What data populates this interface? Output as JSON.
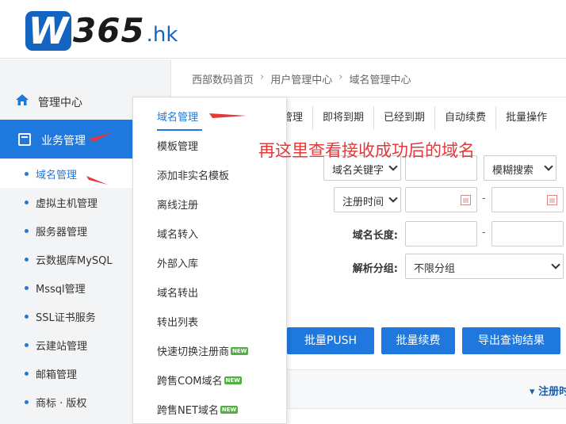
{
  "logo": {
    "mark": "W",
    "number": "365",
    "suffix": ".hk"
  },
  "sidebar": {
    "management_center": "管理中心",
    "business_management": "业务管理",
    "items": [
      "域名管理",
      "虚拟主机管理",
      "服务器管理",
      "云数据库MySQL",
      "Mssql管理",
      "SSL证书服务",
      "云建站管理",
      "邮箱管理",
      "商标 · 版权"
    ]
  },
  "breadcrumb": [
    "西部数码首页",
    "用户管理中心",
    "域名管理中心"
  ],
  "tabs": [
    "管理",
    "即将到期",
    "已经到期",
    "自动续费",
    "批量操作"
  ],
  "annotation": "再这里查看接收成功后的域名",
  "search": {
    "keyword_select": "域名关键字",
    "mode_select": "模糊搜索",
    "date_select": "注册时间",
    "length_label": "域名长度:",
    "group_label": "解析分组:",
    "group_select": "不限分组",
    "dash": "-"
  },
  "buttons": [
    "批量PUSH",
    "批量续费",
    "导出查询结果"
  ],
  "table": {
    "reg_column": "注册时"
  },
  "flyout": {
    "items": [
      {
        "label": "域名管理",
        "new": false
      },
      {
        "label": "模板管理",
        "new": false
      },
      {
        "label": "添加非实名模板",
        "new": false
      },
      {
        "label": "离线注册",
        "new": false
      },
      {
        "label": "域名转入",
        "new": false
      },
      {
        "label": "外部入库",
        "new": false
      },
      {
        "label": "域名转出",
        "new": false
      },
      {
        "label": "转出列表",
        "new": false
      },
      {
        "label": "快速切换注册商",
        "new": true
      },
      {
        "label": "跨售COM域名",
        "new": true
      },
      {
        "label": "跨售NET域名",
        "new": true
      }
    ],
    "new_badge": "NEW"
  },
  "colors": {
    "accent": "#1e78de",
    "annotation": "#e03a3a",
    "badge": "#52b043"
  }
}
